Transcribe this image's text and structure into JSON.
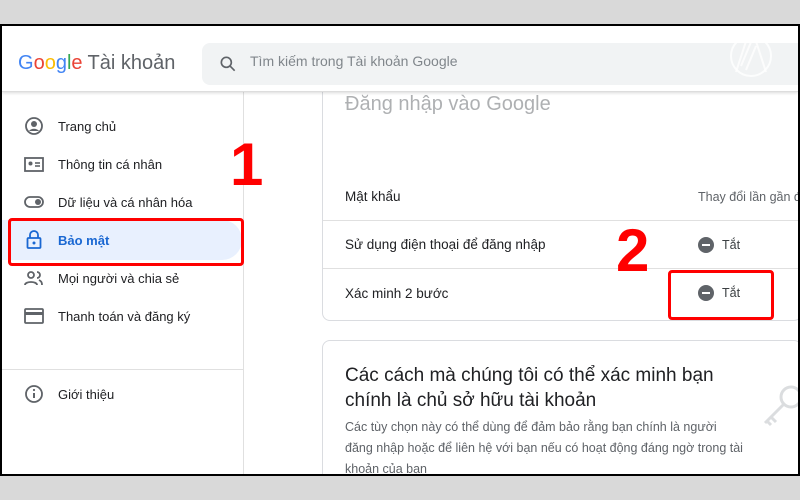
{
  "header": {
    "logo_google": "Google",
    "logo_app": "Tài khoản",
    "search_placeholder": "Tìm kiếm trong Tài khoản Google"
  },
  "sidebar": {
    "items": [
      {
        "label": "Trang chủ",
        "icon": "account-circle-icon"
      },
      {
        "label": "Thông tin cá nhân",
        "icon": "id-card-icon"
      },
      {
        "label": "Dữ liệu và cá nhân hóa",
        "icon": "toggle-icon"
      },
      {
        "label": "Bảo mật",
        "icon": "lock-icon",
        "active": true
      },
      {
        "label": "Mọi người và chia sẻ",
        "icon": "people-icon"
      },
      {
        "label": "Thanh toán và đăng ký",
        "icon": "credit-card-icon"
      },
      {
        "label": "Giới thiệu",
        "icon": "info-icon"
      }
    ]
  },
  "annotations": {
    "step1": "1",
    "step2": "2"
  },
  "signin_card": {
    "title": "Đăng nhập vào Google",
    "rows": [
      {
        "label": "Mật khẩu",
        "value": "Thay đổi lần gần đ"
      },
      {
        "label": "Sử dụng điện thoại để đăng nhập",
        "value": "Tắt"
      },
      {
        "label": "Xác minh 2 bước",
        "value": "Tắt"
      }
    ]
  },
  "verify_card": {
    "title": "Các cách mà chúng tôi có thể xác minh bạn chính là chủ sở hữu tài khoản",
    "description": "Các tùy chọn này có thể dùng để đảm bảo rằng bạn chính là người đăng nhập hoặc để liên hệ với bạn nếu có hoạt động đáng ngờ trong tài khoản của bạn"
  },
  "colors": {
    "accent": "#1967d2",
    "annotation": "#ff0000",
    "active_bg": "#e8f0fe"
  }
}
